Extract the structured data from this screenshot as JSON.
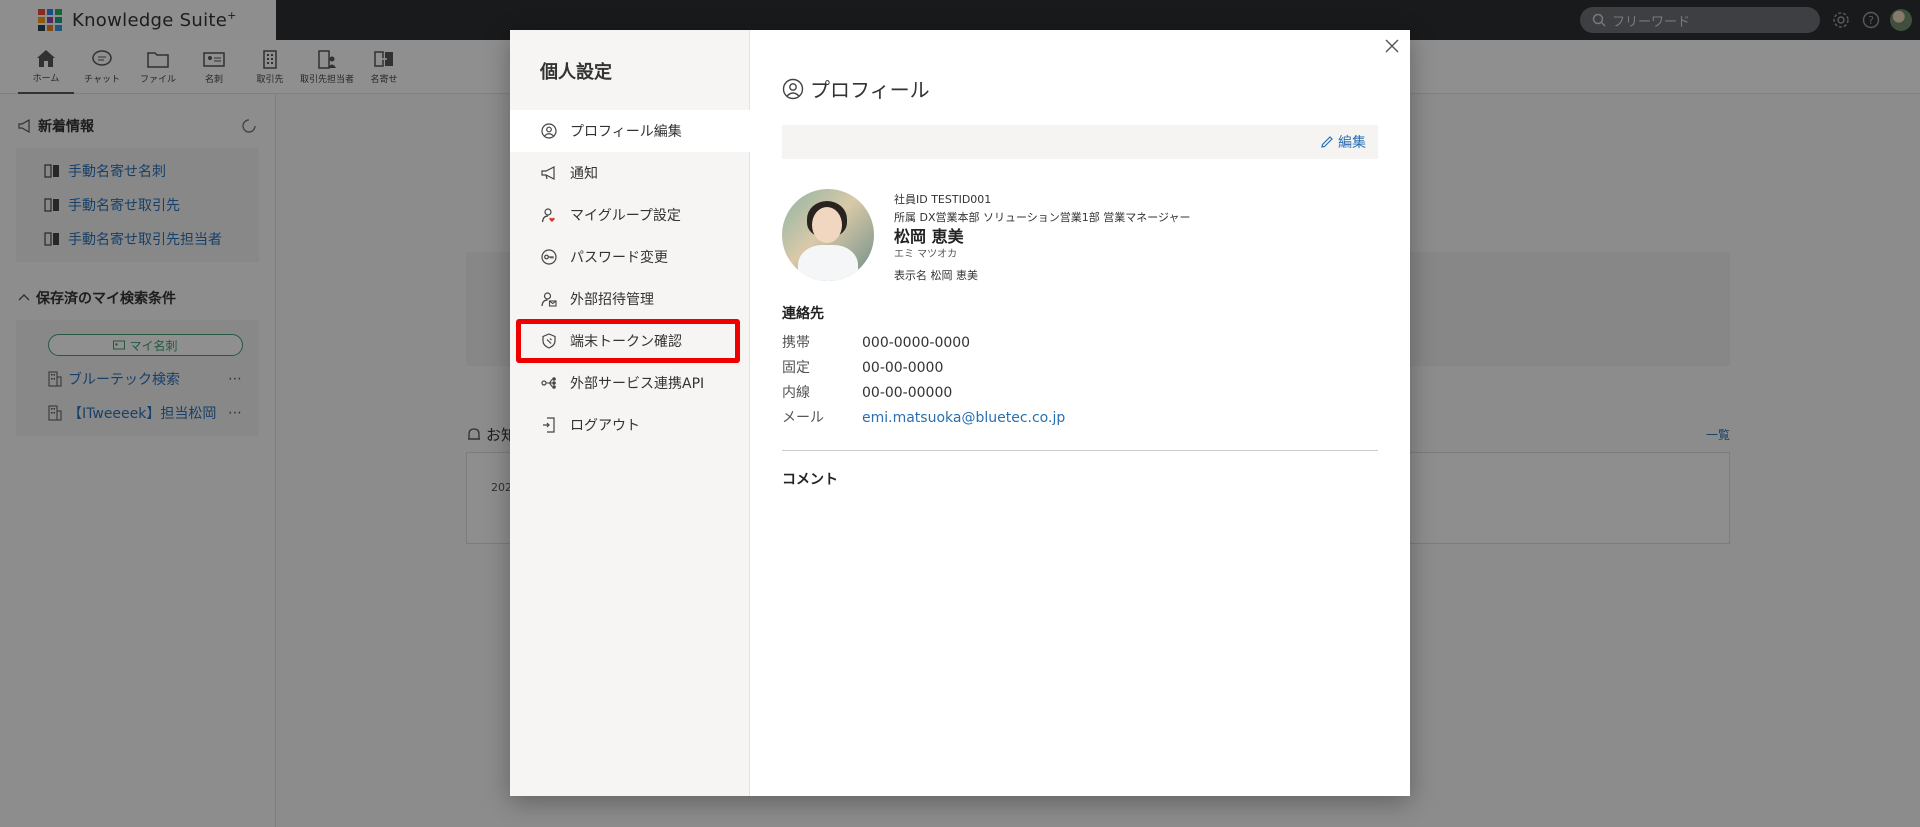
{
  "app": {
    "name": "Knowledge Suite",
    "name_suffix": "+",
    "search_placeholder": "フリーワード"
  },
  "colors": {
    "accent_link": "#2a6fb3",
    "highlight": "#ee0000",
    "green": "#3f9a6e"
  },
  "toolbar": [
    {
      "label": "ホーム",
      "icon": "home-icon",
      "active": true
    },
    {
      "label": "チャット",
      "icon": "chat-icon"
    },
    {
      "label": "ファイル",
      "icon": "folder-icon"
    },
    {
      "label": "名刺",
      "icon": "business-card-icon"
    },
    {
      "label": "取引先",
      "icon": "building-icon"
    },
    {
      "label": "取引先担当者",
      "icon": "contact-building-icon"
    },
    {
      "label": "名寄せ",
      "icon": "merge-icon"
    }
  ],
  "left": {
    "news_title": "新着情報",
    "news_items": [
      "手動名寄せ名刺",
      "手動名寄せ取引先",
      "手動名寄せ取引先担当者"
    ],
    "saved_title": "保存済のマイ検索条件",
    "pill_label": "マイ名刺",
    "saved_items": [
      "ブルーテック検索",
      "【ITweeeek】担当松岡"
    ]
  },
  "background": {
    "notice_label": "お知",
    "list_link": "一覧",
    "card_text": "202"
  },
  "modal": {
    "title": "個人設定",
    "menu": [
      {
        "label": "プロフィール編集",
        "icon": "user-circle-icon"
      },
      {
        "label": "通知",
        "icon": "megaphone-icon"
      },
      {
        "label": "マイグループ設定",
        "icon": "user-heart-icon"
      },
      {
        "label": "パスワード変更",
        "icon": "key-icon"
      },
      {
        "label": "外部招待管理",
        "icon": "user-mail-icon"
      },
      {
        "label": "端末トークン確認",
        "icon": "shield-icon"
      },
      {
        "label": "外部サービス連携API",
        "icon": "network-icon"
      },
      {
        "label": "ログアウト",
        "icon": "logout-icon"
      }
    ],
    "profile": {
      "heading": "プロフィール",
      "edit_label": "編集",
      "employee_id": "社員ID TESTID001",
      "department": "所属 DX営業本部 ソリューション営業1部 営業マネージャー",
      "name": "松岡 恵美",
      "kana": "エミ マツオカ",
      "display_name": "表示名 松岡 恵美",
      "contact_title": "連絡先",
      "contacts": [
        {
          "label": "携帯",
          "value": "000-0000-0000"
        },
        {
          "label": "固定",
          "value": "00-00-0000"
        },
        {
          "label": "内線",
          "value": "00-00-00000"
        },
        {
          "label": "メール",
          "value": "emi.matsuoka@bluetec.co.jp"
        }
      ],
      "comment_title": "コメント"
    }
  }
}
